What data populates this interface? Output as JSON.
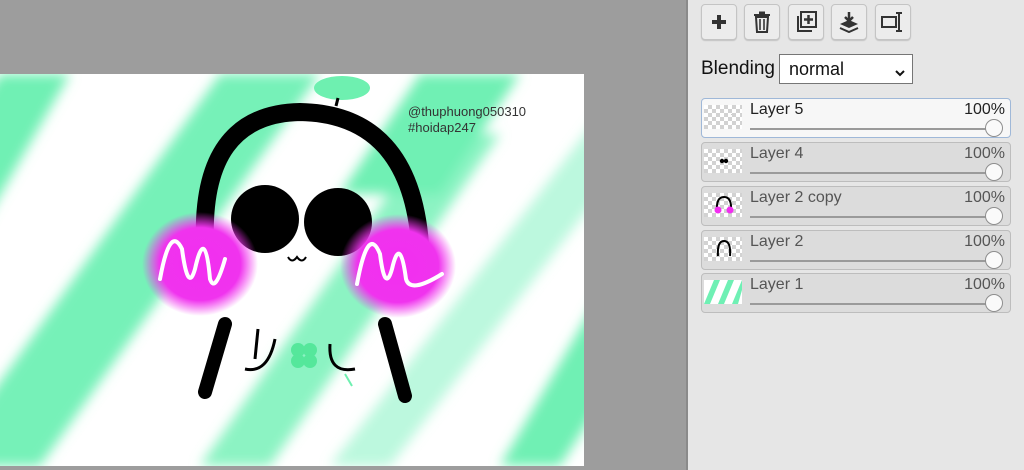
{
  "canvas": {
    "watermark_line1": "@thuphuong050310",
    "watermark_line2": "#hoidap247"
  },
  "toolbar": {
    "add_layer_icon": "plus-icon",
    "delete_layer_icon": "trash-icon",
    "duplicate_layer_icon": "duplicate-icon",
    "merge_down_icon": "merge-down-icon",
    "layer_properties_icon": "properties-icon"
  },
  "blending": {
    "label": "Blending",
    "selected": "normal"
  },
  "layers": [
    {
      "name": "Layer 5",
      "opacity": "100%",
      "active": true
    },
    {
      "name": "Layer 4",
      "opacity": "100%",
      "active": false
    },
    {
      "name": "Layer 2 copy",
      "opacity": "100%",
      "active": false
    },
    {
      "name": "Layer 2",
      "opacity": "100%",
      "active": false
    },
    {
      "name": "Layer 1",
      "opacity": "100%",
      "active": false
    }
  ],
  "colors": {
    "stripe_green": "#6ff0b4",
    "blush_magenta": "#f22ef0",
    "panel_bg": "#e6e6e6",
    "workspace_bg": "#9d9d9d"
  }
}
